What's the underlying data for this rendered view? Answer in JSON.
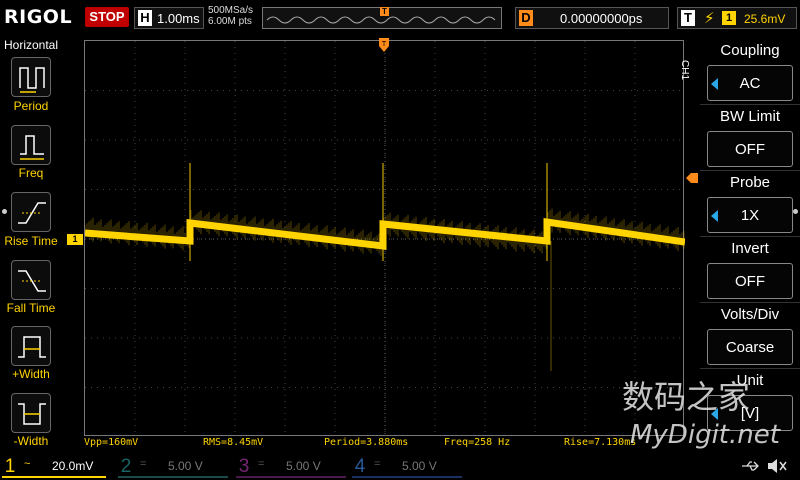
{
  "brand": "RIGOL",
  "run_state": "STOP",
  "timebase": {
    "letter": "H",
    "value": "1.00ms",
    "sample_rate": "500MSa/s",
    "memory_depth": "6.00M pts"
  },
  "trigger_marker": "T",
  "delay": {
    "letter": "D",
    "value": "0.00000000ps"
  },
  "trigger": {
    "letter": "T",
    "edge_icon": "rising-edge",
    "channel": "1",
    "level": "25.6mV"
  },
  "left_menu": {
    "title": "Horizontal",
    "items": [
      {
        "label": "Period",
        "icon": "period-icon"
      },
      {
        "label": "Freq",
        "icon": "freq-icon"
      },
      {
        "label": "Rise Time",
        "icon": "rise-time-icon"
      },
      {
        "label": "Fall Time",
        "icon": "fall-time-icon"
      },
      {
        "label": "+Width",
        "icon": "pos-width-icon"
      },
      {
        "label": "-Width",
        "icon": "neg-width-icon"
      }
    ]
  },
  "ch1_marker": "1",
  "measurements": {
    "vpp": "Vpp=160mV",
    "rms": "RMS=8.45mV",
    "period": "Period=3.880ms",
    "freq": "Freq=258 Hz",
    "rise": "Rise=7.130ms"
  },
  "right_menu": {
    "channel": "CH1",
    "items": [
      {
        "label": "Coupling",
        "value": "AC",
        "arrow": true
      },
      {
        "label": "BW Limit",
        "value": "OFF",
        "arrow": false
      },
      {
        "label": "Probe",
        "value": "1X",
        "arrow": true
      },
      {
        "label": "Invert",
        "value": "OFF",
        "arrow": false
      },
      {
        "label": "Volts/Div",
        "value": "Coarse",
        "arrow": false
      },
      {
        "label": "Unit",
        "value": "[V]",
        "arrow": true
      }
    ]
  },
  "channels": [
    {
      "num": "1",
      "coupling": "~",
      "scale": "20.0mV",
      "color": "#ffd400",
      "active": true
    },
    {
      "num": "2",
      "coupling": "=",
      "scale": "5.00 V",
      "color": "#2aa7a7",
      "active": false
    },
    {
      "num": "3",
      "coupling": "=",
      "scale": "5.00 V",
      "color": "#c040c0",
      "active": false
    },
    {
      "num": "4",
      "coupling": "=",
      "scale": "5.00 V",
      "color": "#3a7fd8",
      "active": false
    }
  ],
  "watermark": {
    "line1": "数码之家",
    "line2": "MyDigit.net"
  },
  "colors": {
    "ch1": "#ffd400",
    "trigger": "#ff8c1a",
    "stop": "#c00000",
    "menu_arrow": "#2aa7e8"
  }
}
